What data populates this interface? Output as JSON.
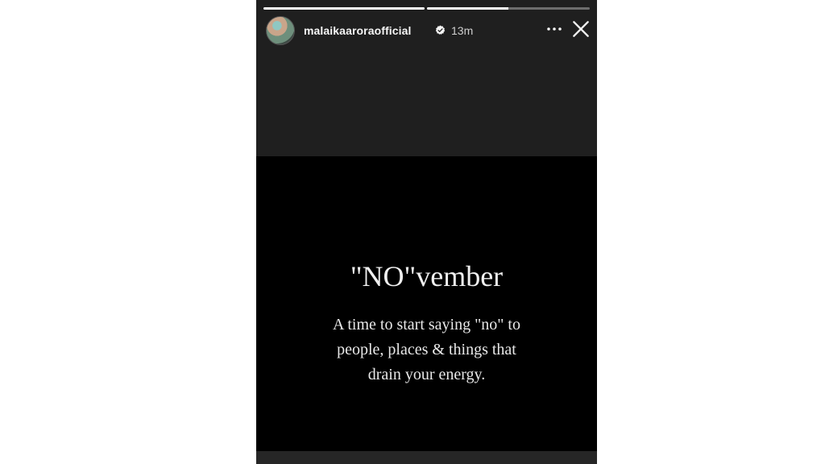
{
  "story": {
    "progress": [
      1.0,
      0.5
    ],
    "header": {
      "username": "malaikaaroraofficial",
      "verified": true,
      "time": "13m",
      "more_icon": "more-horizontal-icon",
      "close_icon": "close-icon"
    },
    "content": {
      "title": "\"NO\"vember",
      "lines": [
        "A time to start saying \"no\" to",
        "people, places & things that",
        "drain your energy."
      ]
    }
  }
}
